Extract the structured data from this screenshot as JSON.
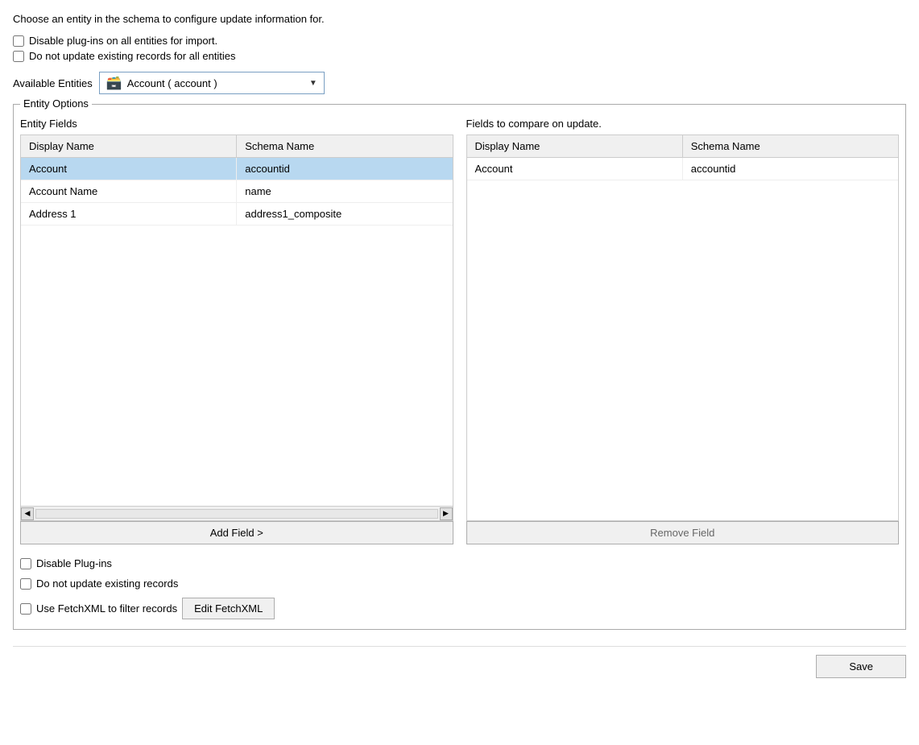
{
  "page": {
    "description": "Choose an entity in the schema to configure update information for.",
    "global_checkboxes": [
      {
        "id": "cb-disable-plugins",
        "label": "Disable plug-ins on all entities for import.",
        "checked": false
      },
      {
        "id": "cb-no-update",
        "label": "Do not update existing records for all entities",
        "checked": false
      }
    ],
    "available_entities_label": "Available Entities",
    "entity_dropdown": {
      "icon": "🗃️",
      "text": "Account  ( account )",
      "arrow": "▼"
    },
    "entity_options": {
      "legend": "Entity Options",
      "left_table": {
        "label": "Entity Fields",
        "headers": [
          "Display Name",
          "Schema Name"
        ],
        "rows": [
          {
            "display": "Account",
            "schema": "accountid",
            "selected": true
          },
          {
            "display": "Account Name",
            "schema": "name",
            "selected": false
          },
          {
            "display": "Address 1",
            "schema": "address1_composite",
            "selected": false
          }
        ]
      },
      "right_table": {
        "label": "Fields to compare on update.",
        "headers": [
          "Display Name",
          "Schema Name"
        ],
        "rows": [
          {
            "display": "Account",
            "schema": "accountid"
          }
        ]
      },
      "add_field_btn": "Add Field >",
      "remove_field_btn": "Remove Field"
    },
    "entity_checkboxes": [
      {
        "id": "cb-disable-plugins-entity",
        "label": "Disable Plug-ins",
        "checked": false
      },
      {
        "id": "cb-no-update-entity",
        "label": "Do not update existing records",
        "checked": false
      },
      {
        "id": "cb-fetchxml",
        "label": "Use FetchXML to filter records",
        "checked": false
      }
    ],
    "edit_fetchxml_btn": "Edit FetchXML",
    "save_btn": "Save"
  }
}
